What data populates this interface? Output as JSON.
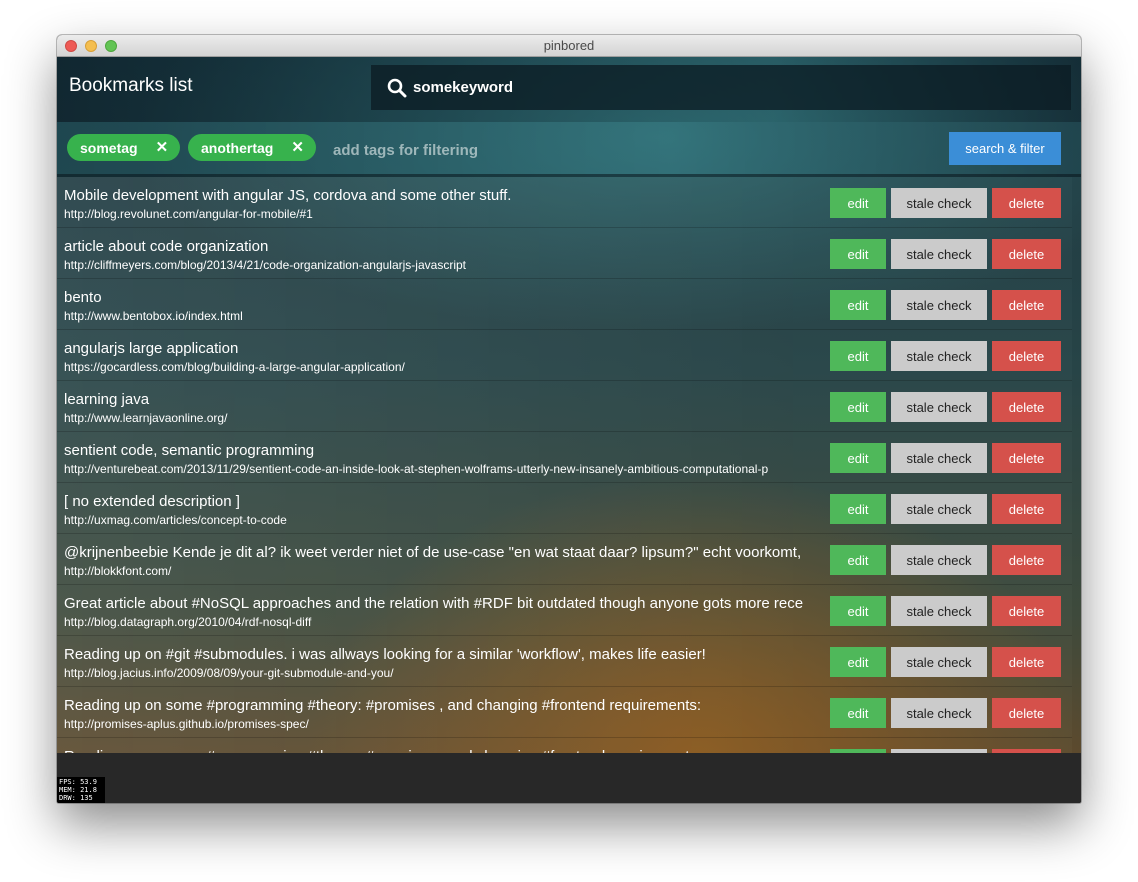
{
  "window": {
    "title": "pinbored"
  },
  "header": {
    "title": "Bookmarks list",
    "search": {
      "value": "somekeyword"
    }
  },
  "tagbar": {
    "tags": [
      {
        "label": "sometag"
      },
      {
        "label": "anothertag"
      }
    ],
    "remove_glyph": "✕",
    "placeholder": "add tags for filtering",
    "filter_button": "search & filter"
  },
  "bookmarks": [
    {
      "title": "Mobile development with angular JS, cordova and some other stuff.",
      "url": "http://blog.revolunet.com/angular-for-mobile/#1"
    },
    {
      "title": "article about code organization",
      "url": "http://cliffmeyers.com/blog/2013/4/21/code-organization-angularjs-javascript"
    },
    {
      "title": "bento",
      "url": "http://www.bentobox.io/index.html"
    },
    {
      "title": "angularjs large application",
      "url": "https://gocardless.com/blog/building-a-large-angular-application/"
    },
    {
      "title": "learning java",
      "url": "http://www.learnjavaonline.org/"
    },
    {
      "title": "sentient code, semantic programming",
      "url": "http://venturebeat.com/2013/11/29/sentient-code-an-inside-look-at-stephen-wolframs-utterly-new-insanely-ambitious-computational-p"
    },
    {
      "title": "[ no extended description ]",
      "url": "http://uxmag.com/articles/concept-to-code"
    },
    {
      "title": "@krijnenbeebie Kende je dit al?  ik weet verder niet of de use-case \"en wat staat daar? lipsum?\" echt voorkomt,",
      "url": "http://blokkfont.com/"
    },
    {
      "title": "Great article about #NoSQL approaches and the relation with #RDF  bit outdated though anyone gots more rece",
      "url": "http://blog.datagraph.org/2010/04/rdf-nosql-diff"
    },
    {
      "title": "Reading up on #git #submodules. i was allways looking for a similar 'workflow', makes life easier!",
      "url": "http://blog.jacius.info/2009/08/09/your-git-submodule-and-you/"
    },
    {
      "title": "Reading up on some #programming #theory: #promises , and changing #frontend requirements:",
      "url": "http://promises-aplus.github.io/promises-spec/"
    },
    {
      "title": "Reading up on some #programming #theory: #promises , and changing #frontend requirements:",
      "url": ""
    }
  ],
  "row_actions": {
    "edit": "edit",
    "stale_check": "stale check",
    "delete": "delete"
  },
  "stats": {
    "fps": "FPS: 53.9",
    "mem": "MEM: 21.8",
    "drw": "DRW: 135"
  }
}
